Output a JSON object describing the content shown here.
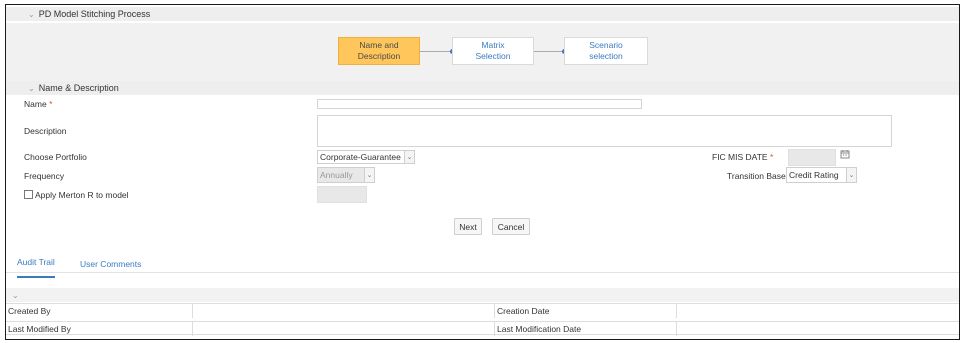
{
  "process": {
    "title": "PD Model Stitching Process"
  },
  "flow": {
    "steps": [
      {
        "label_l1": "Name and",
        "label_l2": "Description"
      },
      {
        "label_l1": "Matrix",
        "label_l2": "Selection"
      },
      {
        "label_l1": "Scenario",
        "label_l2": "selection"
      }
    ],
    "active_step": 0
  },
  "name_desc": {
    "title": "Name & Description",
    "name_label": "Name",
    "required_mark": "*",
    "description_label": "Description",
    "portfolio_label": "Choose Portfolio",
    "portfolio_value": "Corporate-Guarantee",
    "frequency_label": "Frequency",
    "frequency_value": "Annually",
    "merton_label": "Apply Merton R to model",
    "fic_label": "FIC MIS DATE",
    "transition_label": "Transition Base",
    "transition_value": "Credit Rating"
  },
  "buttons": {
    "next": "Next",
    "cancel": "Cancel"
  },
  "tabs": [
    "Audit Trail",
    "User Comments"
  ],
  "audit": {
    "created_by_label": "Created By",
    "creation_date_label": "Creation Date",
    "last_modified_by_label": "Last Modified By",
    "last_modification_date_label": "Last Modification Date"
  },
  "icons": {
    "calendar": "calendar-icon",
    "chevron": "chevron-down-icon"
  },
  "colors": {
    "accent": "#3a7bbf",
    "active_step": "#ffc65b",
    "required": "#e74c3c"
  }
}
